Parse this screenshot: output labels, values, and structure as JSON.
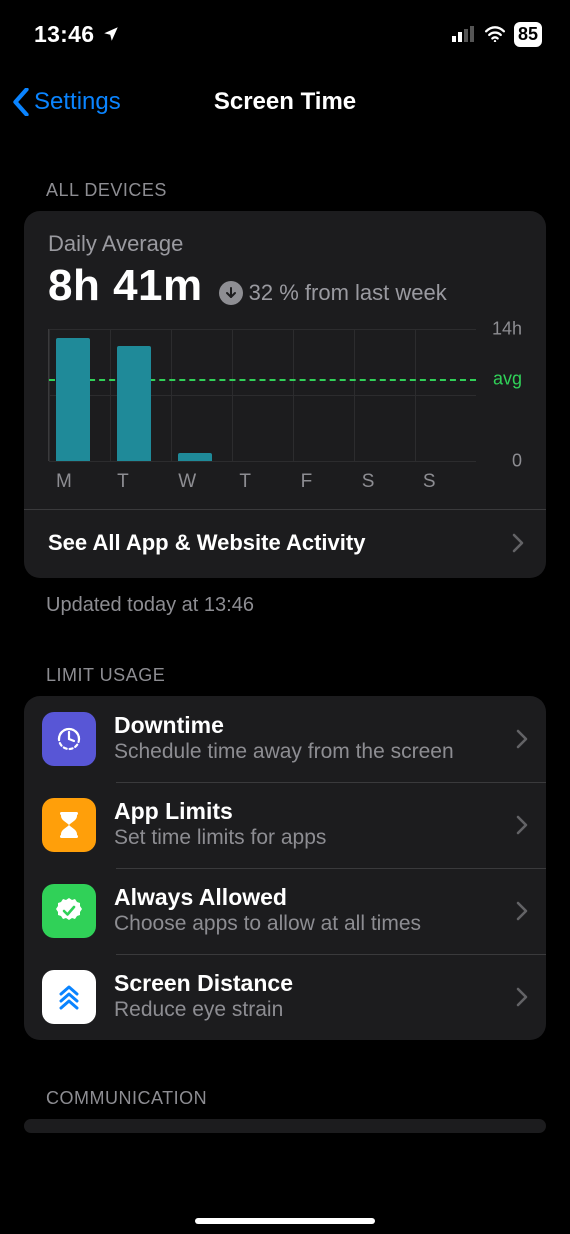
{
  "status": {
    "time": "13:46",
    "battery": "85"
  },
  "nav": {
    "back": "Settings",
    "title": "Screen Time"
  },
  "section_all_devices": "All Devices",
  "summary": {
    "daily_label": "Daily Average",
    "daily_value": "8h 41m",
    "trend_text": "32 % from last week"
  },
  "chart_data": {
    "type": "bar",
    "categories": [
      "M",
      "T",
      "W",
      "T",
      "F",
      "S",
      "S"
    ],
    "values": [
      13.0,
      12.2,
      0.9,
      0,
      0,
      0,
      0
    ],
    "ylim": [
      0,
      14
    ],
    "ytick_top": "14h",
    "ytick_bottom": "0",
    "avg_value": 8.68,
    "avg_label": "avg"
  },
  "see_all": "See All App & Website Activity",
  "updated": "Updated today at 13:46",
  "section_limit": "Limit Usage",
  "rows": {
    "downtime": {
      "title": "Downtime",
      "sub": "Schedule time away from the screen"
    },
    "applimits": {
      "title": "App Limits",
      "sub": "Set time limits for apps"
    },
    "always": {
      "title": "Always Allowed",
      "sub": "Choose apps to allow at all times"
    },
    "distance": {
      "title": "Screen Distance",
      "sub": "Reduce eye strain"
    }
  },
  "section_comm": "Communication"
}
